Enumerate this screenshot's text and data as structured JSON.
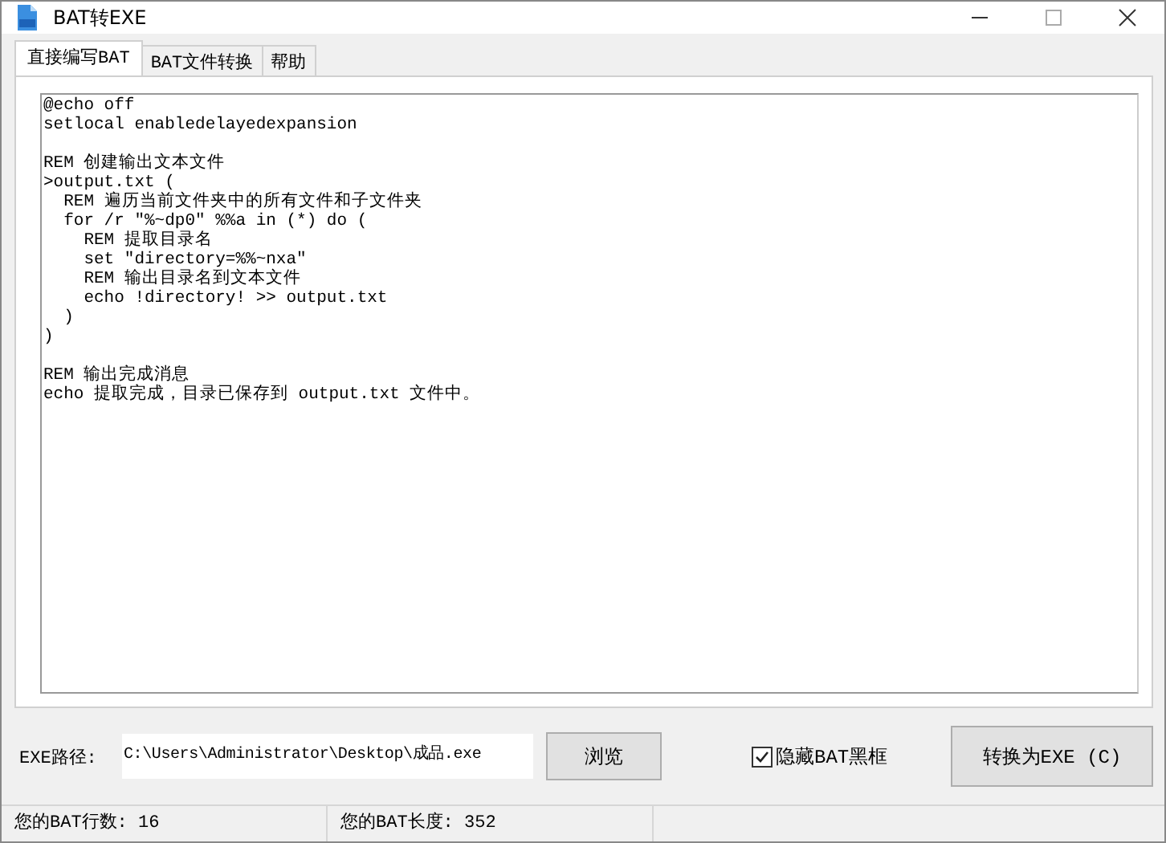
{
  "window": {
    "title": "BAT转EXE"
  },
  "tabs": [
    {
      "label": "直接编写BAT",
      "selected": true
    },
    {
      "label": "BAT文件转换",
      "selected": false
    },
    {
      "label": "帮助",
      "selected": false
    }
  ],
  "editor": {
    "value": "@echo off\nsetlocal enabledelayedexpansion\n\nREM 创建输出文本文件\n>output.txt (\n  REM 遍历当前文件夹中的所有文件和子文件夹\n  for /r \"%~dp0\" %%a in (*) do (\n    REM 提取目录名\n    set \"directory=%%~nxa\"\n    REM 输出目录名到文本文件\n    echo !directory! >> output.txt\n  )\n)\n\nREM 输出完成消息\necho 提取完成，目录已保存到 output.txt 文件中。"
  },
  "exe_path": {
    "label": "EXE路径:",
    "value": "C:\\Users\\Administrator\\Desktop\\成品.exe"
  },
  "browse_button": "浏览",
  "hide_console": {
    "label": "隐藏BAT黑框",
    "checked": true
  },
  "convert_button": "转换为EXE (C)",
  "status_bar": [
    "您的BAT行数: 16",
    "您的BAT长度: 352"
  ]
}
